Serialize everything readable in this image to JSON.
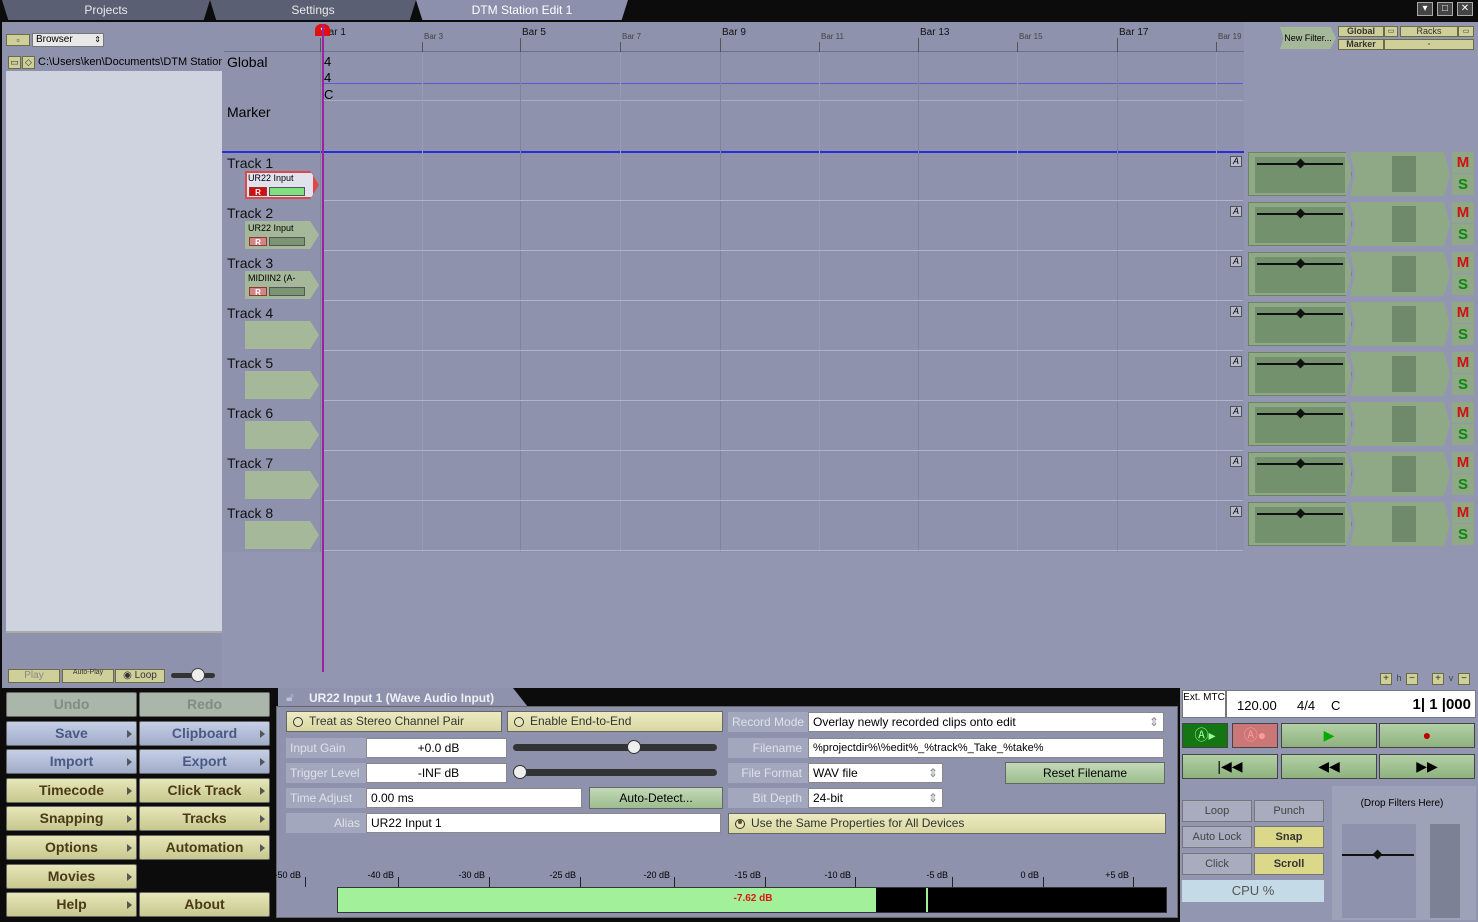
{
  "tabs": {
    "projects": "Projects",
    "settings": "Settings",
    "edit": "DTM Station Edit 1"
  },
  "browser": {
    "dropdown": "Browser",
    "path": "C:\\Users\\ken\\Documents\\DTM Station",
    "play": "Play",
    "autoplay": "Auto-Play",
    "loop": "Loop"
  },
  "ruler": {
    "bars": [
      "Bar 1",
      "Bar 3",
      "Bar 5",
      "Bar 7",
      "Bar 9",
      "Bar 11",
      "Bar 13",
      "Bar 15",
      "Bar 17",
      "Bar 19"
    ]
  },
  "global": {
    "label": "Global",
    "sig_top": "4",
    "sig_bottom": "4",
    "key": "C"
  },
  "marker": {
    "label": "Marker"
  },
  "tracks": [
    {
      "name": "Track 1",
      "input": "UR22 Input",
      "rec": "R"
    },
    {
      "name": "Track 2",
      "input": "UR22 Input",
      "rec": "R"
    },
    {
      "name": "Track 3",
      "input": "MIDIIN2 (A-",
      "rec": "R"
    },
    {
      "name": "Track 4",
      "input": "",
      "rec": ""
    },
    {
      "name": "Track 5",
      "input": "",
      "rec": ""
    },
    {
      "name": "Track 6",
      "input": "",
      "rec": ""
    },
    {
      "name": "Track 7",
      "input": "",
      "rec": ""
    },
    {
      "name": "Track 8",
      "input": "",
      "rec": ""
    }
  ],
  "mixer": {
    "new_filter": "New Filter...",
    "global": "Global",
    "racks": "Racks",
    "marker": "Marker",
    "auto": "A",
    "mute": "M",
    "solo": "S"
  },
  "left_buttons": {
    "undo": "Undo",
    "redo": "Redo",
    "save": "Save",
    "clipboard": "Clipboard",
    "import": "Import",
    "export": "Export",
    "timecode": "Timecode",
    "click_track": "Click Track",
    "snapping": "Snapping",
    "tracks": "Tracks",
    "options": "Options",
    "automation": "Automation",
    "movies": "Movies",
    "help": "Help",
    "about": "About"
  },
  "props": {
    "title": "UR22 Input 1 (Wave Audio Input)",
    "stereo": "Treat as Stereo Channel Pair",
    "end_to_end": "Enable End-to-End",
    "input_gain_label": "Input Gain",
    "input_gain": "+0.0 dB",
    "input_gain_level": 0.6,
    "trigger_label": "Trigger Level",
    "trigger": "-INF dB",
    "trigger_level": 0.0,
    "time_adjust_label": "Time Adjust",
    "time_adjust": "0.00 ms",
    "auto_detect": "Auto-Detect...",
    "alias_label": "Alias",
    "alias": "UR22 Input 1",
    "record_mode_label": "Record Mode",
    "record_mode": "Overlay newly recorded clips onto edit",
    "filename_label": "Filename",
    "filename": "%projectdir%\\%edit%_%track%_Take_%take%",
    "file_format_label": "File Format",
    "file_format": "WAV file",
    "reset_filename": "Reset Filename",
    "bit_depth_label": "Bit Depth",
    "bit_depth": "24-bit",
    "same_props": "Use the Same Properties for All Devices",
    "meter_ticks": [
      "-50 dB",
      "-40 dB",
      "-30 dB",
      "-25 dB",
      "-20 dB",
      "-15 dB",
      "-10 dB",
      "-5 dB",
      "0 dB",
      "+5 dB"
    ],
    "meter_value": "-7.62 dB",
    "meter_level": 0.65
  },
  "transport": {
    "ext_mtc": "Ext. MTC",
    "tempo": "120.00",
    "timesig": "4/4",
    "key": "C",
    "position": "1| 1 |000",
    "loop": "Loop",
    "punch": "Punch",
    "auto_lock": "Auto Lock",
    "snap": "Snap",
    "click": "Click",
    "scroll": "Scroll",
    "cpu": "CPU %",
    "drop_filters": "(Drop Filters Here)"
  },
  "colors": {
    "accent_green": "#8fa886",
    "record_red": "#cc1111",
    "playhead": "#a020a0"
  }
}
